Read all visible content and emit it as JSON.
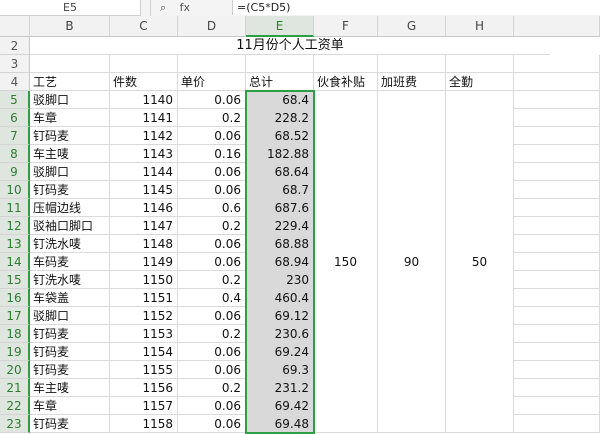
{
  "formula_bar": {
    "name_box": "E5",
    "icons": [
      "zoom-icon",
      "fx-icon"
    ],
    "icon_glyphs": [
      "⌕",
      "fx"
    ],
    "formula": "=(C5*D5)"
  },
  "columns": [
    "B",
    "C",
    "D",
    "E",
    "F",
    "G",
    "H"
  ],
  "row_numbers": [
    "2",
    "3",
    "4",
    "5",
    "6",
    "7",
    "8",
    "9",
    "10",
    "11",
    "12",
    "13",
    "14",
    "15",
    "16",
    "17",
    "18",
    "19",
    "20",
    "21",
    "22",
    "23"
  ],
  "title": "11月份个人工资单",
  "headers": [
    "工艺",
    "件数",
    "单价",
    "总计",
    "伙食补贴",
    "加班费",
    "全勤"
  ],
  "rows": [
    [
      "驳脚口",
      "1140",
      "0.06",
      "68.4"
    ],
    [
      "车章",
      "1141",
      "0.2",
      "228.2"
    ],
    [
      "钉码麦",
      "1142",
      "0.06",
      "68.52"
    ],
    [
      "车主唛",
      "1143",
      "0.16",
      "182.88"
    ],
    [
      "驳脚口",
      "1144",
      "0.06",
      "68.64"
    ],
    [
      "钉码麦",
      "1145",
      "0.06",
      "68.7"
    ],
    [
      "压帽边线",
      "1146",
      "0.6",
      "687.6"
    ],
    [
      "驳袖口脚口",
      "1147",
      "0.2",
      "229.4"
    ],
    [
      "钉洗水唛",
      "1148",
      "0.06",
      "68.88"
    ],
    [
      "车码麦",
      "1149",
      "0.06",
      "68.94"
    ],
    [
      "钉洗水唛",
      "1150",
      "0.2",
      "230"
    ],
    [
      "车袋盖",
      "1151",
      "0.4",
      "460.4"
    ],
    [
      "驳脚口",
      "1152",
      "0.06",
      "69.12"
    ],
    [
      "钉码麦",
      "1153",
      "0.2",
      "230.6"
    ],
    [
      "钉码麦",
      "1154",
      "0.06",
      "69.24"
    ],
    [
      "钉码麦",
      "1155",
      "0.06",
      "69.3"
    ],
    [
      "车主唛",
      "1156",
      "0.2",
      "231.2"
    ],
    [
      "车章",
      "1157",
      "0.06",
      "69.42"
    ],
    [
      "钉码麦",
      "1158",
      "0.06",
      "69.48"
    ]
  ],
  "merged_values": {
    "meal_allowance": "150",
    "overtime": "90",
    "attendance": "50"
  }
}
